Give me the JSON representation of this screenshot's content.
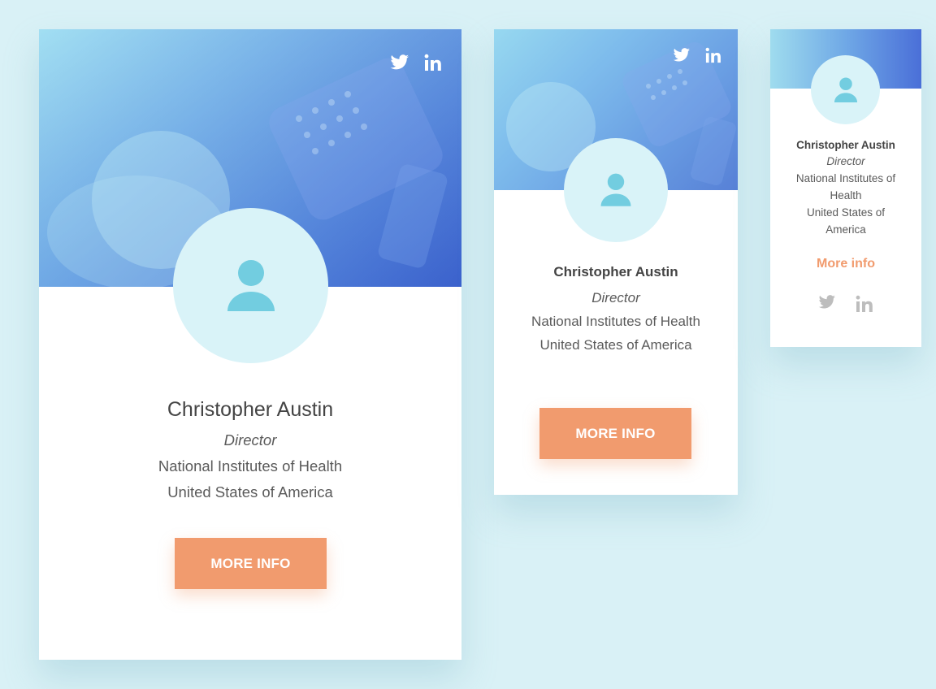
{
  "profile": {
    "name": "Christopher Austin",
    "role": "Director",
    "organization": "National Institutes of Health",
    "country": "United States of America"
  },
  "small_card": {
    "organization_line1": "National Institutes of",
    "organization_line2": "Health",
    "country_line1": "United States of",
    "country_line2": "America",
    "more_link": "More info"
  },
  "button_label": "MORE INFO",
  "icons": {
    "twitter": "twitter-icon",
    "linkedin": "linkedin-icon",
    "avatar": "user-icon"
  },
  "colors": {
    "background": "#d9f1f6",
    "accent": "#f19b6e",
    "avatar_bg": "#d9f3f8",
    "avatar_icon": "#72cde0",
    "hero_blue": "#4f79d8"
  }
}
